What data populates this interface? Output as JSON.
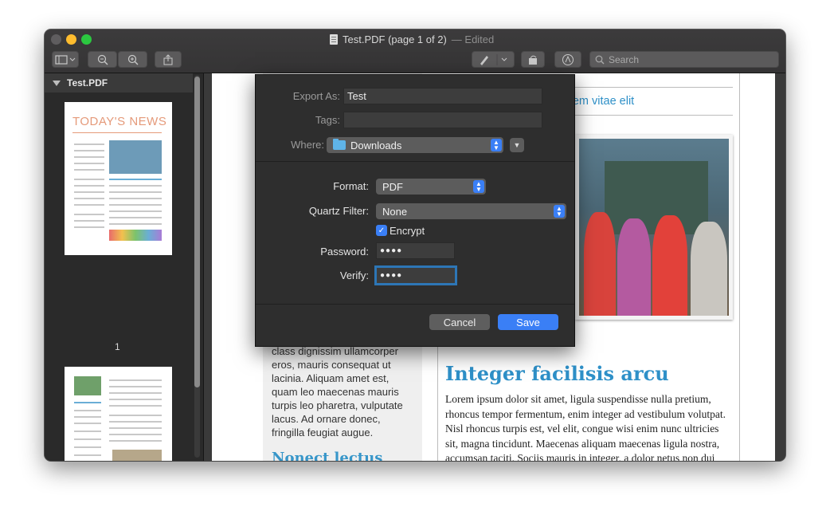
{
  "window": {
    "title": "Test.PDF (page 1 of 2)",
    "title_suffix": "— Edited"
  },
  "toolbar": {
    "sidebar_button": "sidebar-icon",
    "zoom_out": "zoom-out-icon",
    "zoom_in": "zoom-in-icon",
    "share": "share-icon",
    "markup": "pen-icon",
    "rotate": "rotate-icon",
    "annotate": "markup-icon",
    "search_placeholder": "Search"
  },
  "sidebar": {
    "file_name": "Test.PDF",
    "thumb1_title": "TODAY'S NEWS",
    "page1_label": "1"
  },
  "document": {
    "top_line": "rem vitae elit",
    "side_text": "class dignissim ullamcorper eros, mauris consequat ut lacinia. Aliquam amet est, quam leo maecenas mauris turpis leo pharetra, vulputate lacus. Ad ornare donec, fringilla feugiat augue.",
    "side_heading": "Nonect lectus",
    "main_heading": "Integer facilisis arcu",
    "main_text": "Lorem ipsum dolor sit amet, ligula suspendisse nulla pretium, rhoncus tempor fermentum, enim integer ad vestibulum volutpat. Nisl rhoncus turpis est, vel elit, congue wisi enim nunc ultricies sit, magna tincidunt. Maecenas aliquam maecenas ligula nostra, accumsan taciti. Sociis mauris in integer, a dolor netus non dui aliquet, sagittis felis sodales, dolor sociis mauris, vel eu libero cras. Faucibus at. Arcu"
  },
  "dialog": {
    "export_as_label": "Export As:",
    "export_as_value": "Test",
    "tags_label": "Tags:",
    "tags_value": "",
    "where_label": "Where:",
    "where_value": "Downloads",
    "format_label": "Format:",
    "format_value": "PDF",
    "quartz_label": "Quartz Filter:",
    "quartz_value": "None",
    "encrypt_label": "Encrypt",
    "encrypt_checked": true,
    "password_label": "Password:",
    "password_value": "●●●●",
    "verify_label": "Verify:",
    "verify_value": "●●●●",
    "cancel_label": "Cancel",
    "save_label": "Save",
    "accent_color": "#3a7ff6"
  }
}
